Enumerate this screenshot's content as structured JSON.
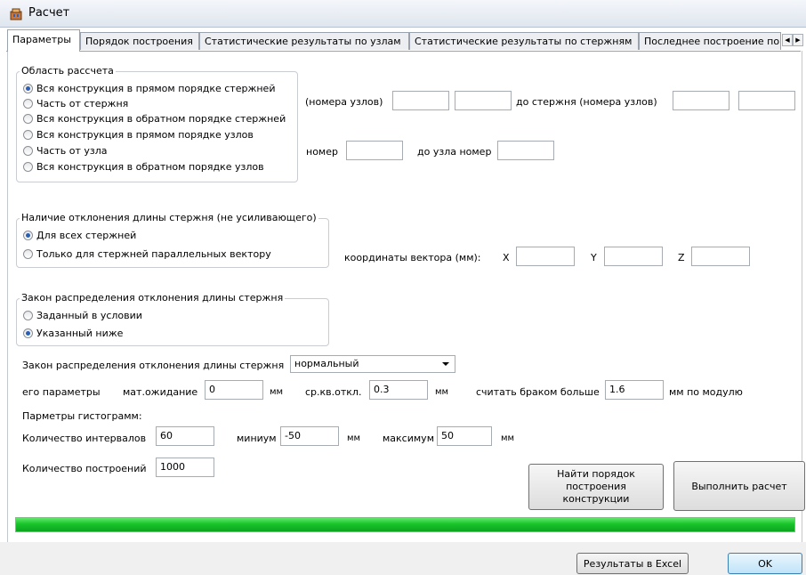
{
  "window": {
    "title": "Расчет"
  },
  "tabs": [
    "Параметры",
    "Порядок построения",
    "Статистические результаты по узлам",
    "Статистические результаты по стержням",
    "Последнее построение по"
  ],
  "calc_area": {
    "legend": "Область рассчета",
    "options": [
      "Вся конструкция в прямом порядке стержней",
      "Часть от стержня",
      "Вся конструкция в обратном порядке стержней",
      "Вся конструкция в прямом порядке узлов",
      "Часть от узла",
      "Вся конструкция в обратном порядке узлов"
    ],
    "selected": 0,
    "rod_nodes_label": "(номера узлов)",
    "to_rod_label": "до стержня (номера узлов)",
    "node_number_label": "номер",
    "to_node_label": "до узла номер"
  },
  "deviation": {
    "legend": "Наличие отклонения длины стержня (не усиливающего)",
    "options": [
      "Для всех стержней",
      "Только для стержней параллельных вектору"
    ],
    "selected": 0,
    "vector_label": "координаты вектора (мм):",
    "x_label": "X",
    "y_label": "Y",
    "z_label": "Z"
  },
  "distribution": {
    "legend": "Закон распределения отклонения длины стержня",
    "options": [
      "Заданный в условии",
      "Указанный ниже"
    ],
    "selected": 1
  },
  "law": {
    "label": "Закон распределения отклонения длины стержня",
    "value": "нормальный"
  },
  "params": {
    "label": "его параметры",
    "mean_label": "мат.ожидание",
    "mean_value": "0",
    "mean_unit": "мм",
    "std_label": "ср.кв.откл.",
    "std_value": "0.3",
    "std_unit": "мм",
    "defect_label": "считать браком больше",
    "defect_value": "1.6",
    "defect_unit": "мм по модулю"
  },
  "histogram": {
    "title": "Парметры гистограмм:",
    "intervals_label": "Количество интервалов",
    "intervals_value": "60",
    "min_label": "миниум",
    "min_value": "-50",
    "min_unit": "мм",
    "max_label": "максимум",
    "max_value": "50",
    "max_unit": "мм",
    "builds_label": "Количество построений",
    "builds_value": "1000"
  },
  "buttons": {
    "find_order_1": "Найти порядок",
    "find_order_2": "построения",
    "find_order_3": "конструкции",
    "run": "Выполнить расчет",
    "excel": "Результаты в Excel",
    "ok": "OK"
  },
  "progress": {
    "value": 1.0,
    "color": "#17c52a"
  }
}
